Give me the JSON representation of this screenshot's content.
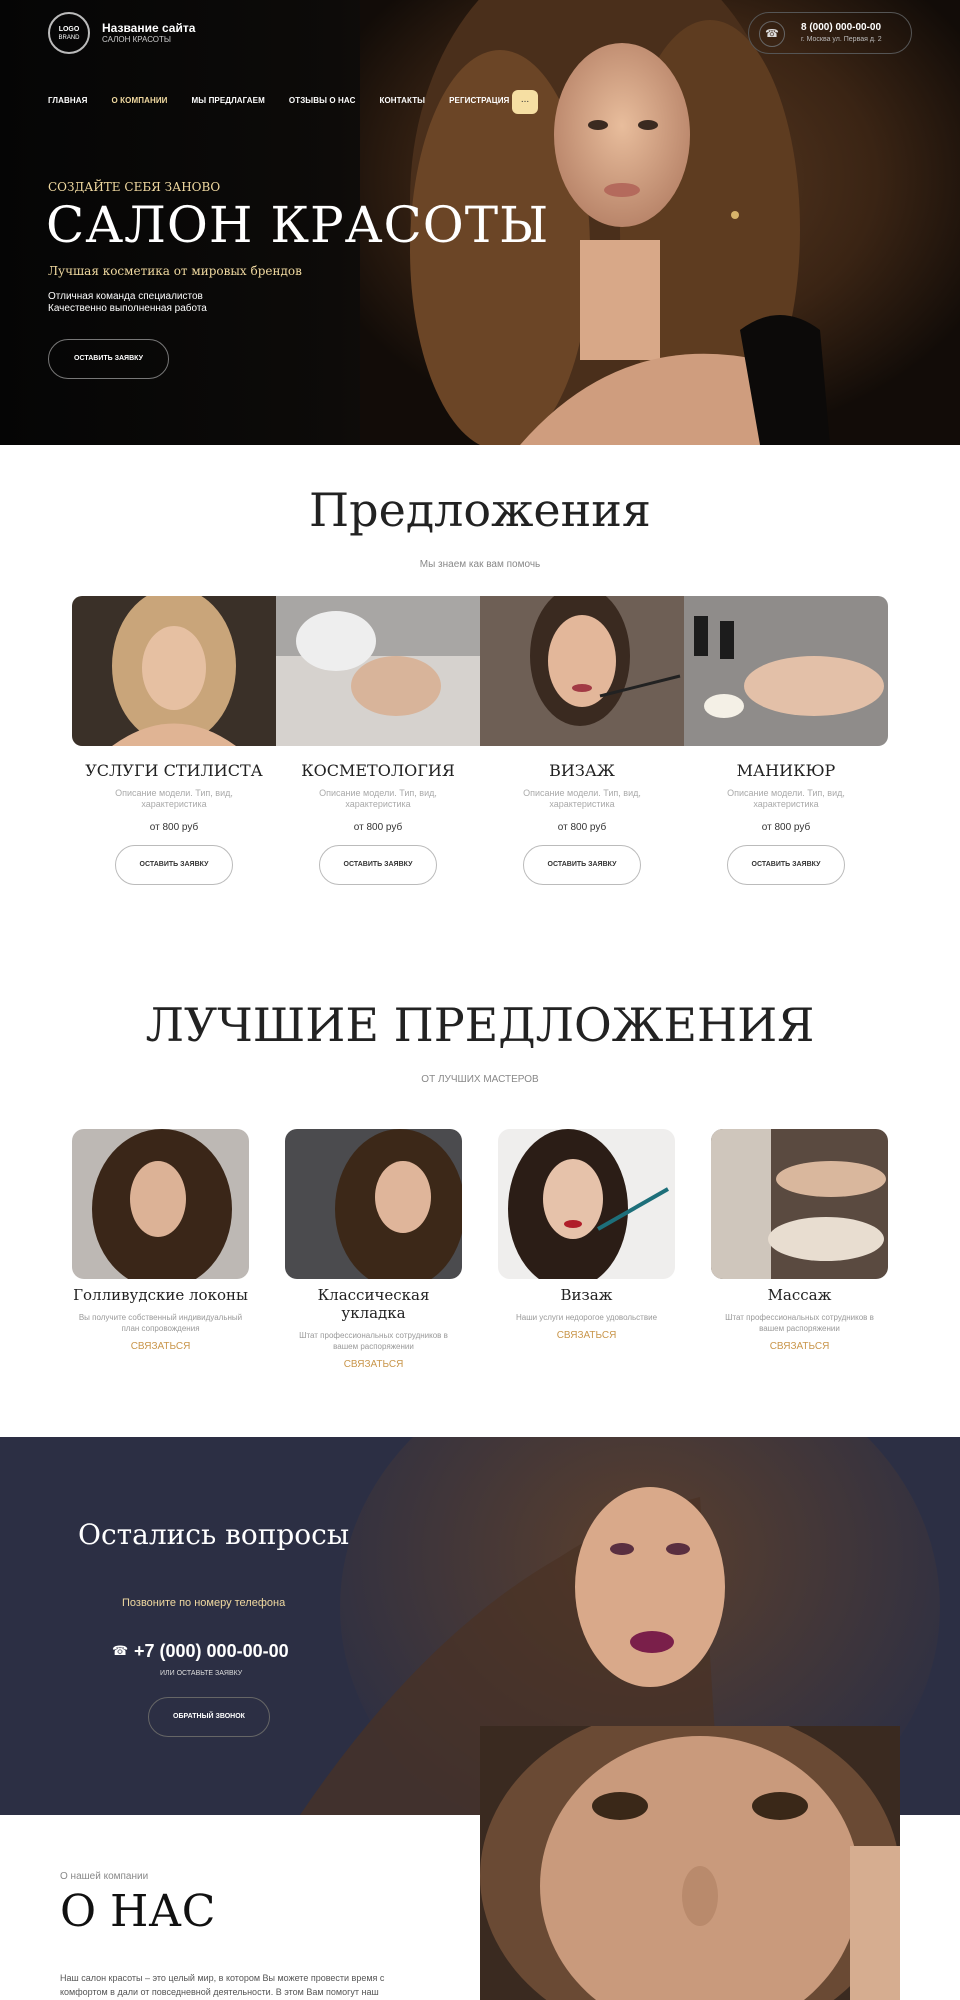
{
  "header": {
    "logo_top": "LOGO",
    "logo_bottom": "BRAND",
    "site_name": "Название сайта",
    "site_subtitle": "САЛОН КРАСОТЫ",
    "phone": "8 (000) 000-00-00",
    "address": "г. Москва ул. Первая д. 2",
    "phone_icon": "phone-icon"
  },
  "nav": {
    "items": [
      "ГЛАВНАЯ",
      "О КОМПАНИИ",
      "МЫ ПРЕДЛАГАЕМ",
      "ОТЗЫВЫ О НАС",
      "КОНТАКТЫ",
      "РЕГИСТРАЦИЯ"
    ],
    "active_index": 1,
    "more_label": "..."
  },
  "hero": {
    "kicker": "СОЗДАЙТЕ СЕБЯ ЗАНОВО",
    "title": "САЛОН КРАСОТЫ",
    "tagline": "Лучшая косметика от мировых брендов",
    "line1": "Отличная команда специалистов",
    "line2": "Качественно выполненная работа",
    "button": "ОСТАВИТЬ ЗАЯВКУ"
  },
  "offers": {
    "title": "Предложения",
    "subtitle": "Мы знаем как вам помочь",
    "items": [
      {
        "name": "УСЛУГИ СТИЛИСТА",
        "desc": "Описание модели. Тип, вид, характеристика",
        "price": "от 800 руб",
        "button": "ОСТАВИТЬ ЗАЯВКУ"
      },
      {
        "name": "КОСМЕТОЛОГИЯ",
        "desc": "Описание модели. Тип, вид, характеристика",
        "price": "от 800 руб",
        "button": "ОСТАВИТЬ ЗАЯВКУ"
      },
      {
        "name": "ВИЗАЖ",
        "desc": "Описание модели. Тип, вид, характеристика",
        "price": "от 800 руб",
        "button": "ОСТАВИТЬ ЗАЯВКУ"
      },
      {
        "name": "МАНИКЮР",
        "desc": "Описание модели. Тип, вид, характеристика",
        "price": "от 800 руб",
        "button": "ОСТАВИТЬ ЗАЯВКУ"
      }
    ]
  },
  "best": {
    "title": "ЛУЧШИЕ ПРЕДЛОЖЕНИЯ",
    "subtitle": "ОТ ЛУЧШИХ МАСТЕРОВ",
    "items": [
      {
        "name": "Голливудские локоны",
        "desc": "Вы получите собственный индивидуальный план сопровождения",
        "link": "СВЯЗАТЬСЯ"
      },
      {
        "name": "Классическая укладка",
        "desc": "Штат профессиональных сотрудников в вашем распоряжении",
        "link": "СВЯЗАТЬСЯ"
      },
      {
        "name": "Визаж",
        "desc": "Наши услуги недорогое удовольствие",
        "link": "СВЯЗАТЬСЯ"
      },
      {
        "name": "Массаж",
        "desc": "Штат профессиональных сотрудников в вашем распоряжении",
        "link": "СВЯЗАТЬСЯ"
      }
    ]
  },
  "questions": {
    "title": "Остались вопросы",
    "call_label": "Позвоните по номеру телефона",
    "phone": "+7 (000) 000-00-00",
    "or_label": "ИЛИ ОСТАВЬТЕ ЗАЯВКУ",
    "button": "ОБРАТНЫЙ ЗВОНОК"
  },
  "about": {
    "kicker": "О нашей компании",
    "title": "О НАС",
    "text": "Наш салон красоты – это целый мир, в котором Вы можете провести время с комфортом в дали от повседневной деятельности. В этом Вам помогут наш"
  },
  "colors": {
    "gold": "#f0d9a0",
    "link": "#c9964b",
    "band": "#2c2f44"
  }
}
